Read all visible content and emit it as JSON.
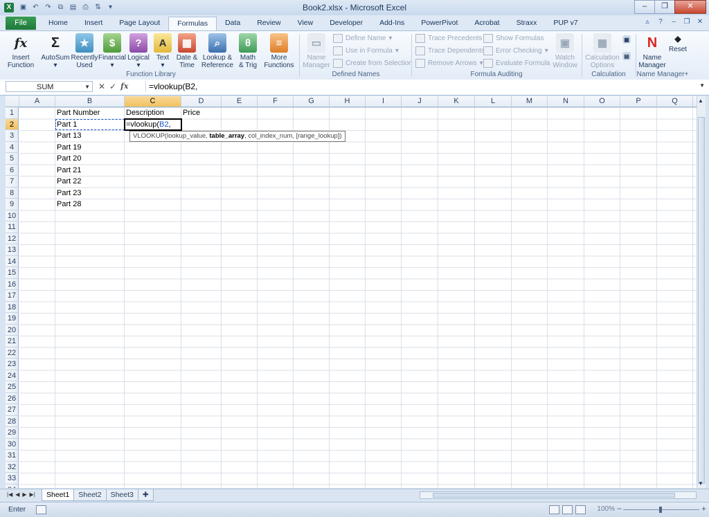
{
  "window": {
    "title": "Book2.xlsx - Microsoft Excel"
  },
  "tabs": {
    "file": "File",
    "items": [
      "Home",
      "Insert",
      "Page Layout",
      "Formulas",
      "Data",
      "Review",
      "View",
      "Developer",
      "Add-Ins",
      "PowerPivot",
      "Acrobat",
      "Straxx",
      "PUP v7"
    ],
    "active": "Formulas"
  },
  "ribbon": {
    "function_library": {
      "label": "Function Library",
      "insert_function": "Insert\nFunction",
      "autosum": "AutoSum",
      "recently_used": "Recently\nUsed",
      "financial": "Financial",
      "logical": "Logical",
      "text": "Text",
      "date_time": "Date &\nTime",
      "lookup_reference": "Lookup &\nReference",
      "math_trig": "Math\n& Trig",
      "more_functions": "More\nFunctions"
    },
    "defined_names": {
      "label": "Defined Names",
      "name_manager": "Name\nManager",
      "define_name": "Define Name",
      "use_in_formula": "Use in Formula",
      "create_from_selection": "Create from Selection"
    },
    "formula_auditing": {
      "label": "Formula Auditing",
      "trace_precedents": "Trace Precedents",
      "trace_dependents": "Trace Dependents",
      "remove_arrows": "Remove Arrows",
      "show_formulas": "Show Formulas",
      "error_checking": "Error Checking",
      "evaluate_formula": "Evaluate Formula",
      "watch_window": "Watch\nWindow"
    },
    "calculation": {
      "label": "Calculation",
      "calculation_options": "Calculation\nOptions"
    },
    "name_manager_plus": {
      "label": "Name Manager+",
      "name_manager": "Name\nManager",
      "reset": "Reset"
    }
  },
  "formula_bar": {
    "name_box": "SUM",
    "formula": "=vlookup(B2,"
  },
  "columns": [
    "A",
    "B",
    "C",
    "D",
    "E",
    "F",
    "G",
    "H",
    "I",
    "J",
    "K",
    "L",
    "M",
    "N",
    "O",
    "P",
    "Q"
  ],
  "rows": [
    "1",
    "2",
    "3",
    "4",
    "5",
    "6",
    "7",
    "8",
    "9",
    "10",
    "11",
    "12",
    "13",
    "14",
    "15",
    "16",
    "17",
    "18",
    "19",
    "20",
    "21",
    "22",
    "23",
    "24",
    "25",
    "26",
    "27",
    "28",
    "29",
    "30",
    "31",
    "32",
    "33",
    "34"
  ],
  "cells": {
    "B1": "Part Number",
    "C1": "Description",
    "D1": "Price",
    "B2": "Part 1",
    "C2_prefix": "=vlookup(",
    "C2_ref": "B2",
    "C2_suffix": ",",
    "B3": "Part 13",
    "B4": "Part 19",
    "B5": "Part 20",
    "B6": "Part 21",
    "B7": "Part 22",
    "B8": "Part 23",
    "B9": "Part 28"
  },
  "tooltip": {
    "fn": "VLOOKUP(",
    "arg1": "lookup_value",
    "arg2": "table_array",
    "arg3": "col_index_num",
    "arg4": "[range_lookup]",
    "close": ")"
  },
  "sheets": [
    "Sheet1",
    "Sheet2",
    "Sheet3"
  ],
  "active_sheet": "Sheet1",
  "status": {
    "mode": "Enter",
    "zoom": "100%"
  }
}
